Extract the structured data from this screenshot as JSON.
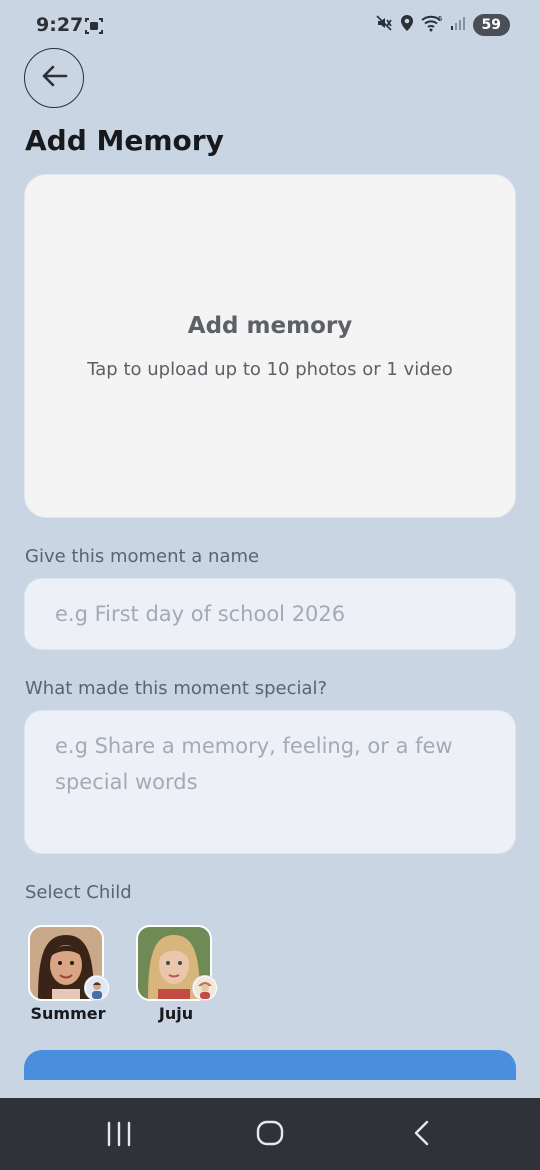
{
  "status_bar": {
    "time": "9:27",
    "battery": "59",
    "icons": [
      "screenshot-icon",
      "mute-icon",
      "location-icon",
      "wifi-icon",
      "signal-icon"
    ]
  },
  "header": {
    "back_icon": "arrow-left-icon",
    "title": "Add Memory"
  },
  "upload": {
    "title": "Add memory",
    "subtitle": "Tap to upload up to 10 photos or 1 video"
  },
  "form": {
    "name_label": "Give this moment a name",
    "name_placeholder": "e.g First day of school 2026",
    "special_label": "What made this moment special?",
    "special_placeholder": "e.g Share a memory, feeling, or a few special words"
  },
  "children": {
    "label": "Select Child",
    "items": [
      {
        "name": "Summer"
      },
      {
        "name": "Juju"
      }
    ]
  },
  "nav": {
    "icons": [
      "recent-apps-icon",
      "home-icon",
      "back-nav-icon"
    ]
  },
  "colors": {
    "background": "#c9d5e3",
    "card": "#f4f4f4",
    "input": "#edf1f7",
    "primary": "#4a8fde"
  }
}
